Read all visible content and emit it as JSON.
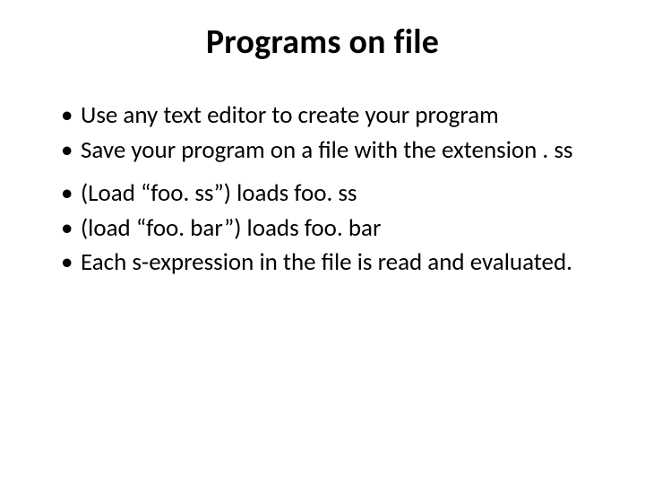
{
  "slide": {
    "title": "Programs on file",
    "bullets": [
      "Use any text editor to create your program",
      "Save your program on a file with the extension . ss",
      "(Load “foo. ss”) loads foo. ss",
      "(load “foo. bar”) loads foo. bar",
      "Each s-expression in the file is read and evaluated."
    ]
  }
}
